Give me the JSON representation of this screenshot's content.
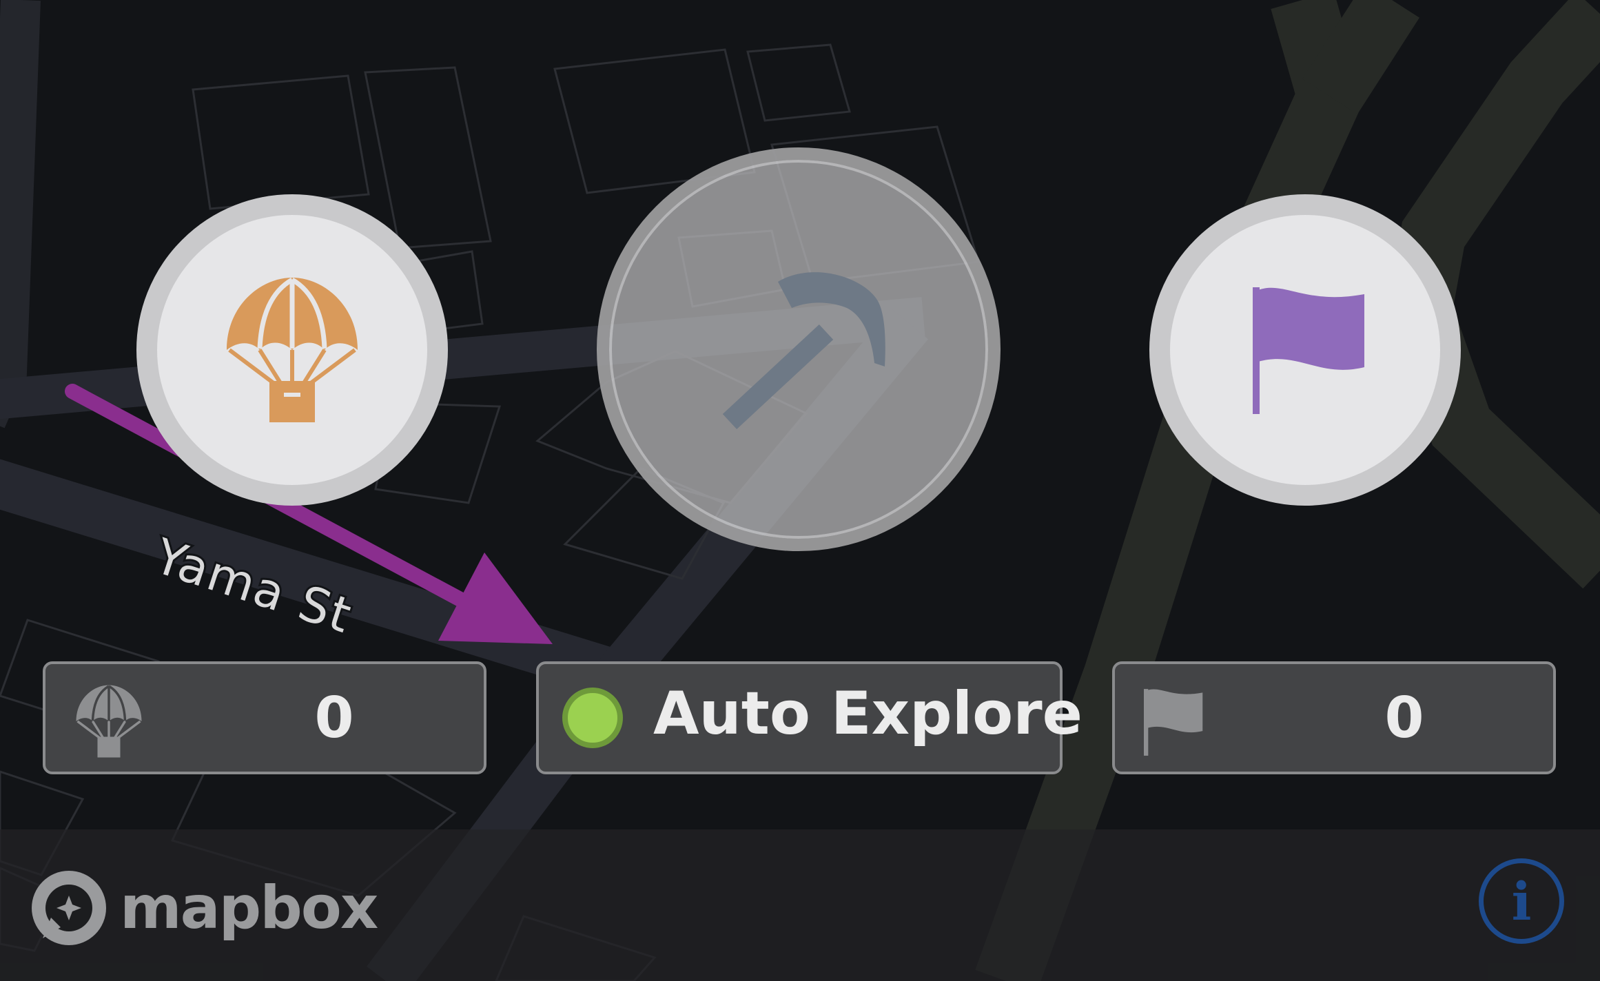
{
  "map": {
    "street_label": "Yama St"
  },
  "buttons": {
    "airdrop_icon": "parachute-crate-icon",
    "mine_icon": "pickaxe-icon",
    "flag_icon": "flag-icon"
  },
  "stats": {
    "airdrops_count": "0",
    "auto_explore_label": "Auto Explore",
    "auto_explore_status_color": "#9bd150",
    "flags_count": "0"
  },
  "attribution": {
    "logo_text": "mapbox",
    "info_label": "i"
  },
  "colors": {
    "airdrop_orange": "#d99a5b",
    "flag_purple": "#8f6bbb",
    "annotation_arrow": "#8a2e8e",
    "info_blue": "#1d4a8c"
  }
}
